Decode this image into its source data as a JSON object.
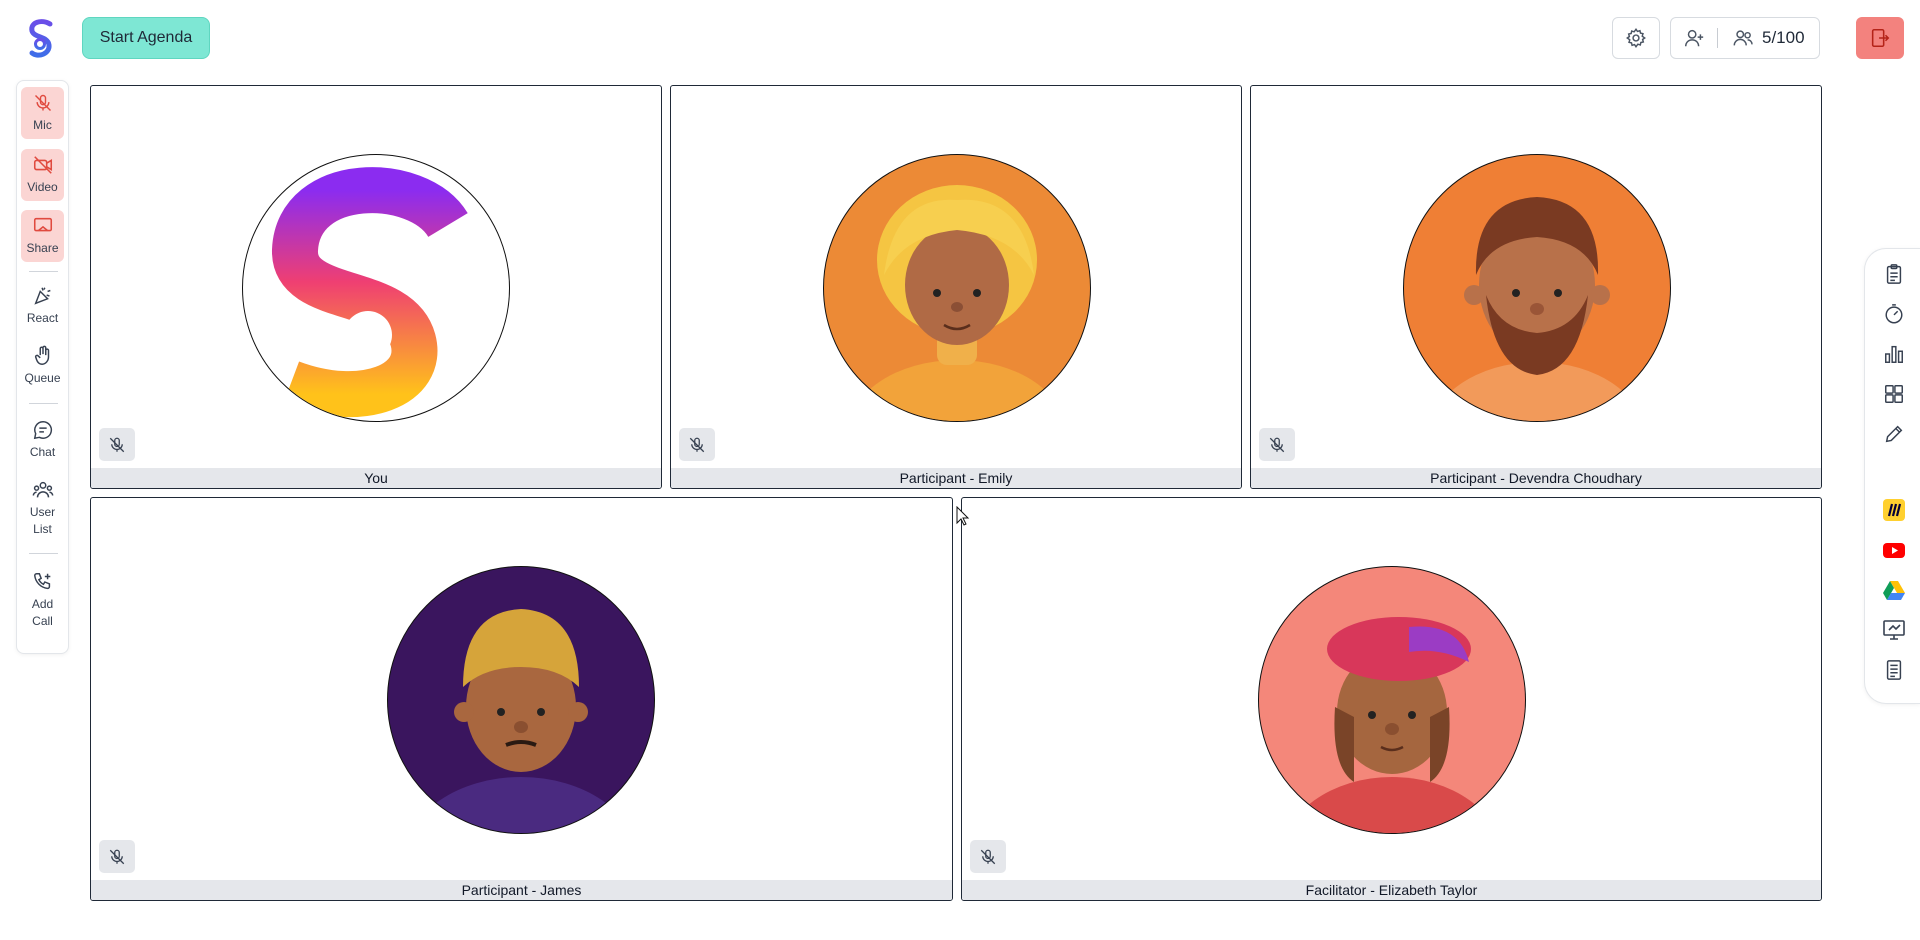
{
  "header": {
    "start_agenda_label": "Start Agenda",
    "participant_count": "5/100"
  },
  "left_rail": {
    "items": [
      {
        "label": "Mic",
        "icon": "mic-off-icon"
      },
      {
        "label": "Video",
        "icon": "video-off-icon"
      },
      {
        "label": "Share",
        "icon": "share-screen-icon"
      },
      {
        "label": "React",
        "icon": "party-popper-icon"
      },
      {
        "label": "Queue",
        "icon": "raise-hand-icon"
      },
      {
        "label": "Chat",
        "icon": "chat-icon"
      },
      {
        "label": "User List",
        "icon": "user-list-icon"
      },
      {
        "label": "Add Call",
        "icon": "add-call-icon"
      }
    ]
  },
  "tiles": [
    {
      "name": "You",
      "avatar": "app-logo",
      "muted": true
    },
    {
      "name": "Participant - Emily",
      "avatar": "emily-avatar",
      "muted": true
    },
    {
      "name": "Participant - Devendra Choudhary",
      "avatar": "devendra-avatar",
      "muted": true
    },
    {
      "name": "Participant - James",
      "avatar": "james-avatar",
      "muted": true
    },
    {
      "name": "Facilitator - Elizabeth Taylor",
      "avatar": "elizabeth-avatar",
      "muted": true
    }
  ],
  "right_rail": {
    "tools": [
      "clipboard-icon",
      "timer-icon",
      "poll-chart-icon",
      "apps-grid-icon",
      "pencil-icon",
      "miro-icon",
      "youtube-icon",
      "google-drive-icon",
      "whiteboard-icon",
      "document-icon"
    ]
  },
  "colors": {
    "start_agenda_bg": "#7ee7d4",
    "leave_bg": "#f3827e",
    "rail_active_bg": "#fbd5d3",
    "name_bar_bg": "#e5e7eb"
  }
}
